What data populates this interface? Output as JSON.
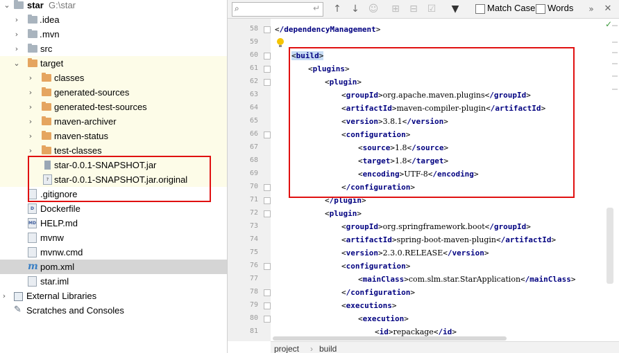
{
  "tree": {
    "root": {
      "label": "star",
      "path": "G:\\star"
    },
    "items": [
      {
        "label": "idea",
        "prefix": "."
      },
      {
        "label": "mvn",
        "prefix": "."
      },
      {
        "label": "src"
      },
      {
        "label": "target"
      },
      {
        "label": "classes"
      },
      {
        "label": "generated-sources"
      },
      {
        "label": "generated-test-sources"
      },
      {
        "label": "maven-archiver"
      },
      {
        "label": "maven-status"
      },
      {
        "label": "test-classes"
      },
      {
        "label": "star-0.0.1-SNAPSHOT.jar"
      },
      {
        "label": "star-0.0.1-SNAPSHOT.jar.original"
      },
      {
        "label": ".gitignore"
      },
      {
        "label": "Dockerfile"
      },
      {
        "label": "HELP.md"
      },
      {
        "label": "mvnw"
      },
      {
        "label": "mvnw.cmd"
      },
      {
        "label": "pom.xml"
      },
      {
        "label": "star.iml"
      },
      {
        "label": "External Libraries"
      },
      {
        "label": "Scratches and Consoles"
      }
    ]
  },
  "search": {
    "match_case": "Match Case",
    "words": "Words",
    "match_case_mnemonic": "C",
    "words_mnemonic": "W"
  },
  "breadcrumb": {
    "items": [
      "project",
      "build"
    ]
  },
  "editor": {
    "line_numbers": [
      "58",
      "59",
      "60",
      "61",
      "62",
      "63",
      "64",
      "65",
      "66",
      "67",
      "68",
      "69",
      "70",
      "71",
      "72",
      "73",
      "74",
      "75",
      "76",
      "77",
      "78",
      "79",
      "80",
      "81"
    ],
    "lines": [
      {
        "open": "/dependencyManagement",
        "close": null,
        "text": null
      },
      {
        "open": null,
        "close": null,
        "text": null
      },
      {
        "open": "build",
        "close": null,
        "text": null
      },
      {
        "open": "plugins",
        "close": null,
        "text": null
      },
      {
        "open": "plugin",
        "close": null,
        "text": null
      },
      {
        "open": "groupId",
        "close": "/groupId",
        "text": "org.apache.maven.plugins"
      },
      {
        "open": "artifactId",
        "close": "/artifactId",
        "text": "maven-compiler-plugin"
      },
      {
        "open": "version",
        "close": "/version",
        "text": "3.8.1"
      },
      {
        "open": "configuration",
        "close": null,
        "text": null
      },
      {
        "open": "source",
        "close": "/source",
        "text": "1.8"
      },
      {
        "open": "target",
        "close": "/target",
        "text": "1.8"
      },
      {
        "open": "encoding",
        "close": "/encoding",
        "text": "UTF-8"
      },
      {
        "open": "/configuration",
        "close": null,
        "text": null
      },
      {
        "open": "/plugin",
        "close": null,
        "text": null
      },
      {
        "open": "plugin",
        "close": null,
        "text": null
      },
      {
        "open": "groupId",
        "close": "/groupId",
        "text": "org.springframework.boot"
      },
      {
        "open": "artifactId",
        "close": "/artifactId",
        "text": "spring-boot-maven-plugin"
      },
      {
        "open": "version",
        "close": "/version",
        "text": "2.3.0.RELEASE"
      },
      {
        "open": "configuration",
        "close": null,
        "text": null
      },
      {
        "open": "mainClass",
        "close": "/mainClass",
        "text": "com.slm.star.StarApplication"
      },
      {
        "open": "/configuration",
        "close": null,
        "text": null
      },
      {
        "open": "executions",
        "close": null,
        "text": null
      },
      {
        "open": "execution",
        "close": null,
        "text": null
      },
      {
        "open": "id",
        "close": "/id",
        "text": "repackage"
      }
    ]
  },
  "colors": {
    "tag": "#000080",
    "highlight_box": "#e01010",
    "target_bg": "#fdfce8",
    "selected_bg": "#d5d5d5"
  }
}
